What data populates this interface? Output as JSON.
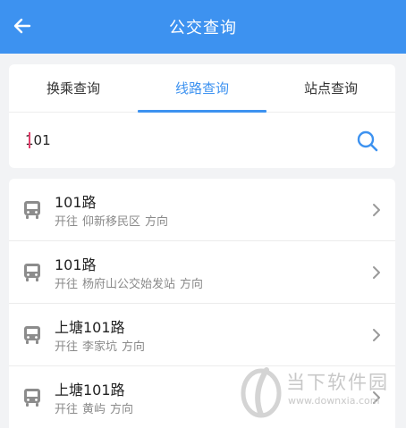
{
  "header": {
    "title": "公交查询",
    "back_icon": "arrow-left-icon"
  },
  "tabs": [
    {
      "label": "换乘查询",
      "active": false
    },
    {
      "label": "线路查询",
      "active": true
    },
    {
      "label": "站点查询",
      "active": false
    }
  ],
  "search": {
    "value": "101",
    "icon": "search-icon"
  },
  "results": [
    {
      "name": "101路",
      "prefix": "开往",
      "destination": "仰新移民区",
      "suffix": "方向"
    },
    {
      "name": "101路",
      "prefix": "开往",
      "destination": "杨府山公交始发站",
      "suffix": "方向"
    },
    {
      "name": "上塘101路",
      "prefix": "开往",
      "destination": "李家坑",
      "suffix": "方向"
    },
    {
      "name": "上塘101路",
      "prefix": "开往",
      "destination": "黄屿",
      "suffix": "方向"
    }
  ],
  "watermark": {
    "name": "当下软件园",
    "url": "www.downxia.com"
  },
  "colors": {
    "primary": "#3d92f0",
    "caret": "#e23d6a",
    "background": "#f2f3f5"
  }
}
